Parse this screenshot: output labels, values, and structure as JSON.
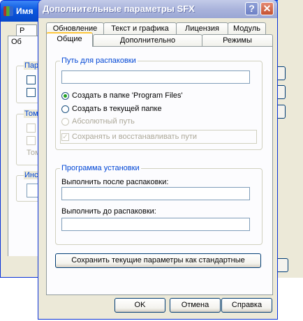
{
  "background_window": {
    "title": "Имя",
    "tab1": "Р",
    "tab2": "Об",
    "group1_label": "Пара",
    "group2_label": "Том",
    "group2_item": "Том",
    "group3_label": "Инс"
  },
  "dialog": {
    "title": "Дополнительные параметры SFX",
    "help_glyph": "?",
    "close_glyph": "✕"
  },
  "tabs": {
    "back_row": [
      "Обновление",
      "Текст и графика",
      "Лицензия",
      "Модуль"
    ],
    "front_row": [
      "Общие",
      "Дополнительно",
      "Режимы"
    ],
    "selected": "Общие"
  },
  "extract_group": {
    "label": "Путь для распаковки",
    "path_value": "",
    "radio_program_files": "Создать в папке 'Program Files'",
    "radio_current_folder": "Создать в текущей папке",
    "radio_absolute": "Абсолютный путь",
    "save_paths": "Сохранять и восстанавливать пути"
  },
  "setup_group": {
    "label": "Программа установки",
    "run_after_label": "Выполнить после распаковки:",
    "run_after_value": "",
    "run_before_label": "Выполнить до распаковки:",
    "run_before_value": ""
  },
  "buttons": {
    "save_defaults": "Сохранить текущие параметры как стандартные",
    "ok": "OK",
    "cancel": "Отмена",
    "help": "Справка"
  }
}
